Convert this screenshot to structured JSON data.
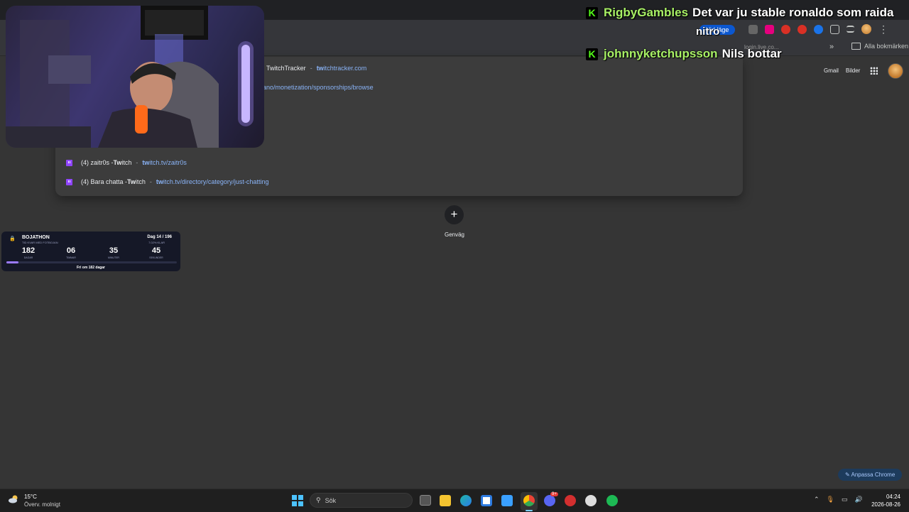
{
  "browser": {
    "update_pill": "Vid läge",
    "bookmarks_overflow": "»",
    "all_bookmarks": "Alla bokmärken",
    "bookmark_login": "login.live.co..."
  },
  "omnibox": {
    "suggestions": [
      {
        "title": "TwitchTracker",
        "url": "twitchtracker.com"
      },
      {
        "title": "",
        "url": "ano/monetization/sponsorships/browse"
      },
      {
        "title_prefix": "(4) zaitr0s - ",
        "title_bold": "Tw",
        "title_rest": "itch",
        "url_bold": "tw",
        "url_rest": "itch.tv/zaitr0s"
      },
      {
        "title_prefix": "(4) Bara chatta - ",
        "title_bold": "Tw",
        "title_rest": "itch",
        "url_bold": "tw",
        "url_rest": "itch.tv/directory/category/just-chatting"
      }
    ]
  },
  "google": {
    "gmail": "Gmail",
    "images": "Bilder",
    "add_shortcut_symbol": "+",
    "shortcut_label": "Genväg",
    "customize": "Anpassa Chrome"
  },
  "chat": {
    "messages": [
      {
        "user": "RigbyGambles",
        "text": "Det var ju stable ronaldo som raida"
      },
      {
        "user": "johnnyketchupsson",
        "text": "Nils bottar"
      }
    ],
    "extra": "nitro"
  },
  "widget": {
    "title": "BOJATHON",
    "subtitle": "TID KVAR MED FOTBOJAN",
    "day": "Dag 14 / 196",
    "percent": "7.02% KLAR",
    "progress": 0.0702,
    "counters": [
      {
        "value": "182",
        "label": "DAGAR"
      },
      {
        "value": "06",
        "label": "TIMMAR"
      },
      {
        "value": "35",
        "label": "MINUTER"
      },
      {
        "value": "45",
        "label": "SEKUNDER"
      }
    ],
    "footer": "Fri om 182 dagar"
  },
  "taskbar": {
    "temperature": "15°C",
    "condition": "Överv. molnigt",
    "search_placeholder": "Sök",
    "time": "04:24",
    "date": "2026-08-26",
    "discord_badge": "9+"
  }
}
